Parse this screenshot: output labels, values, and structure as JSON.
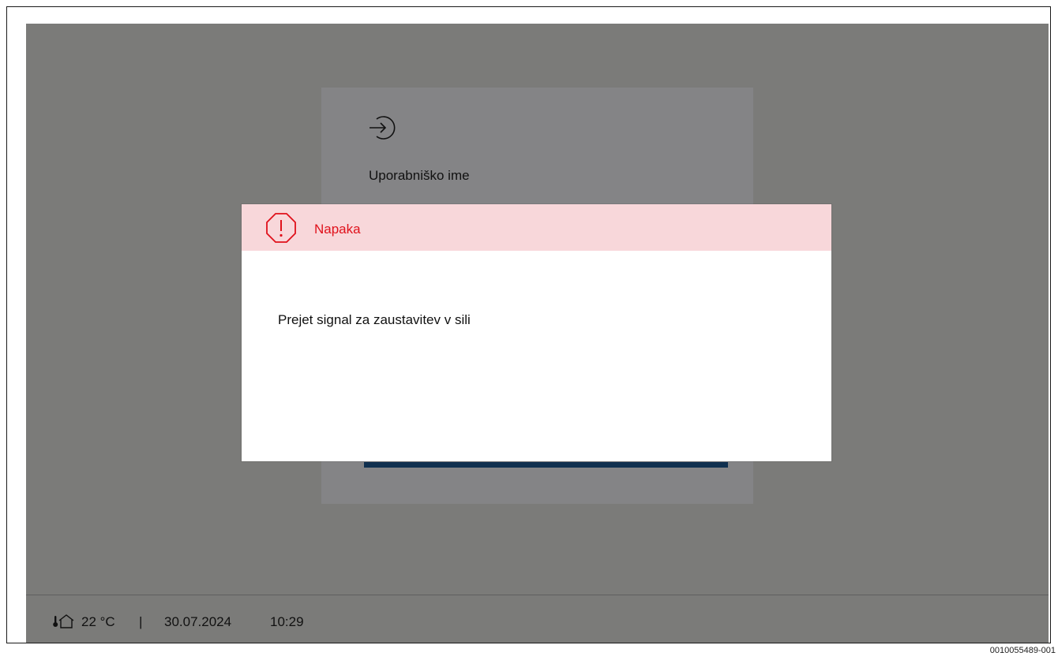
{
  "login": {
    "icon": "login-arrow-icon",
    "username_label": "Uporabniško ime"
  },
  "dialog": {
    "icon": "warning-octagon-icon",
    "title": "Napaka",
    "message": "Prejet signal za zaustavitev v sili",
    "header_color": "#f8d7da",
    "title_color": "#e0111b"
  },
  "statusbar": {
    "icon": "indoor-temperature-icon",
    "temperature": "22 °C",
    "separator": "|",
    "date": "30.07.2024",
    "time": "10:29"
  },
  "doc_id": "0010055489-001"
}
